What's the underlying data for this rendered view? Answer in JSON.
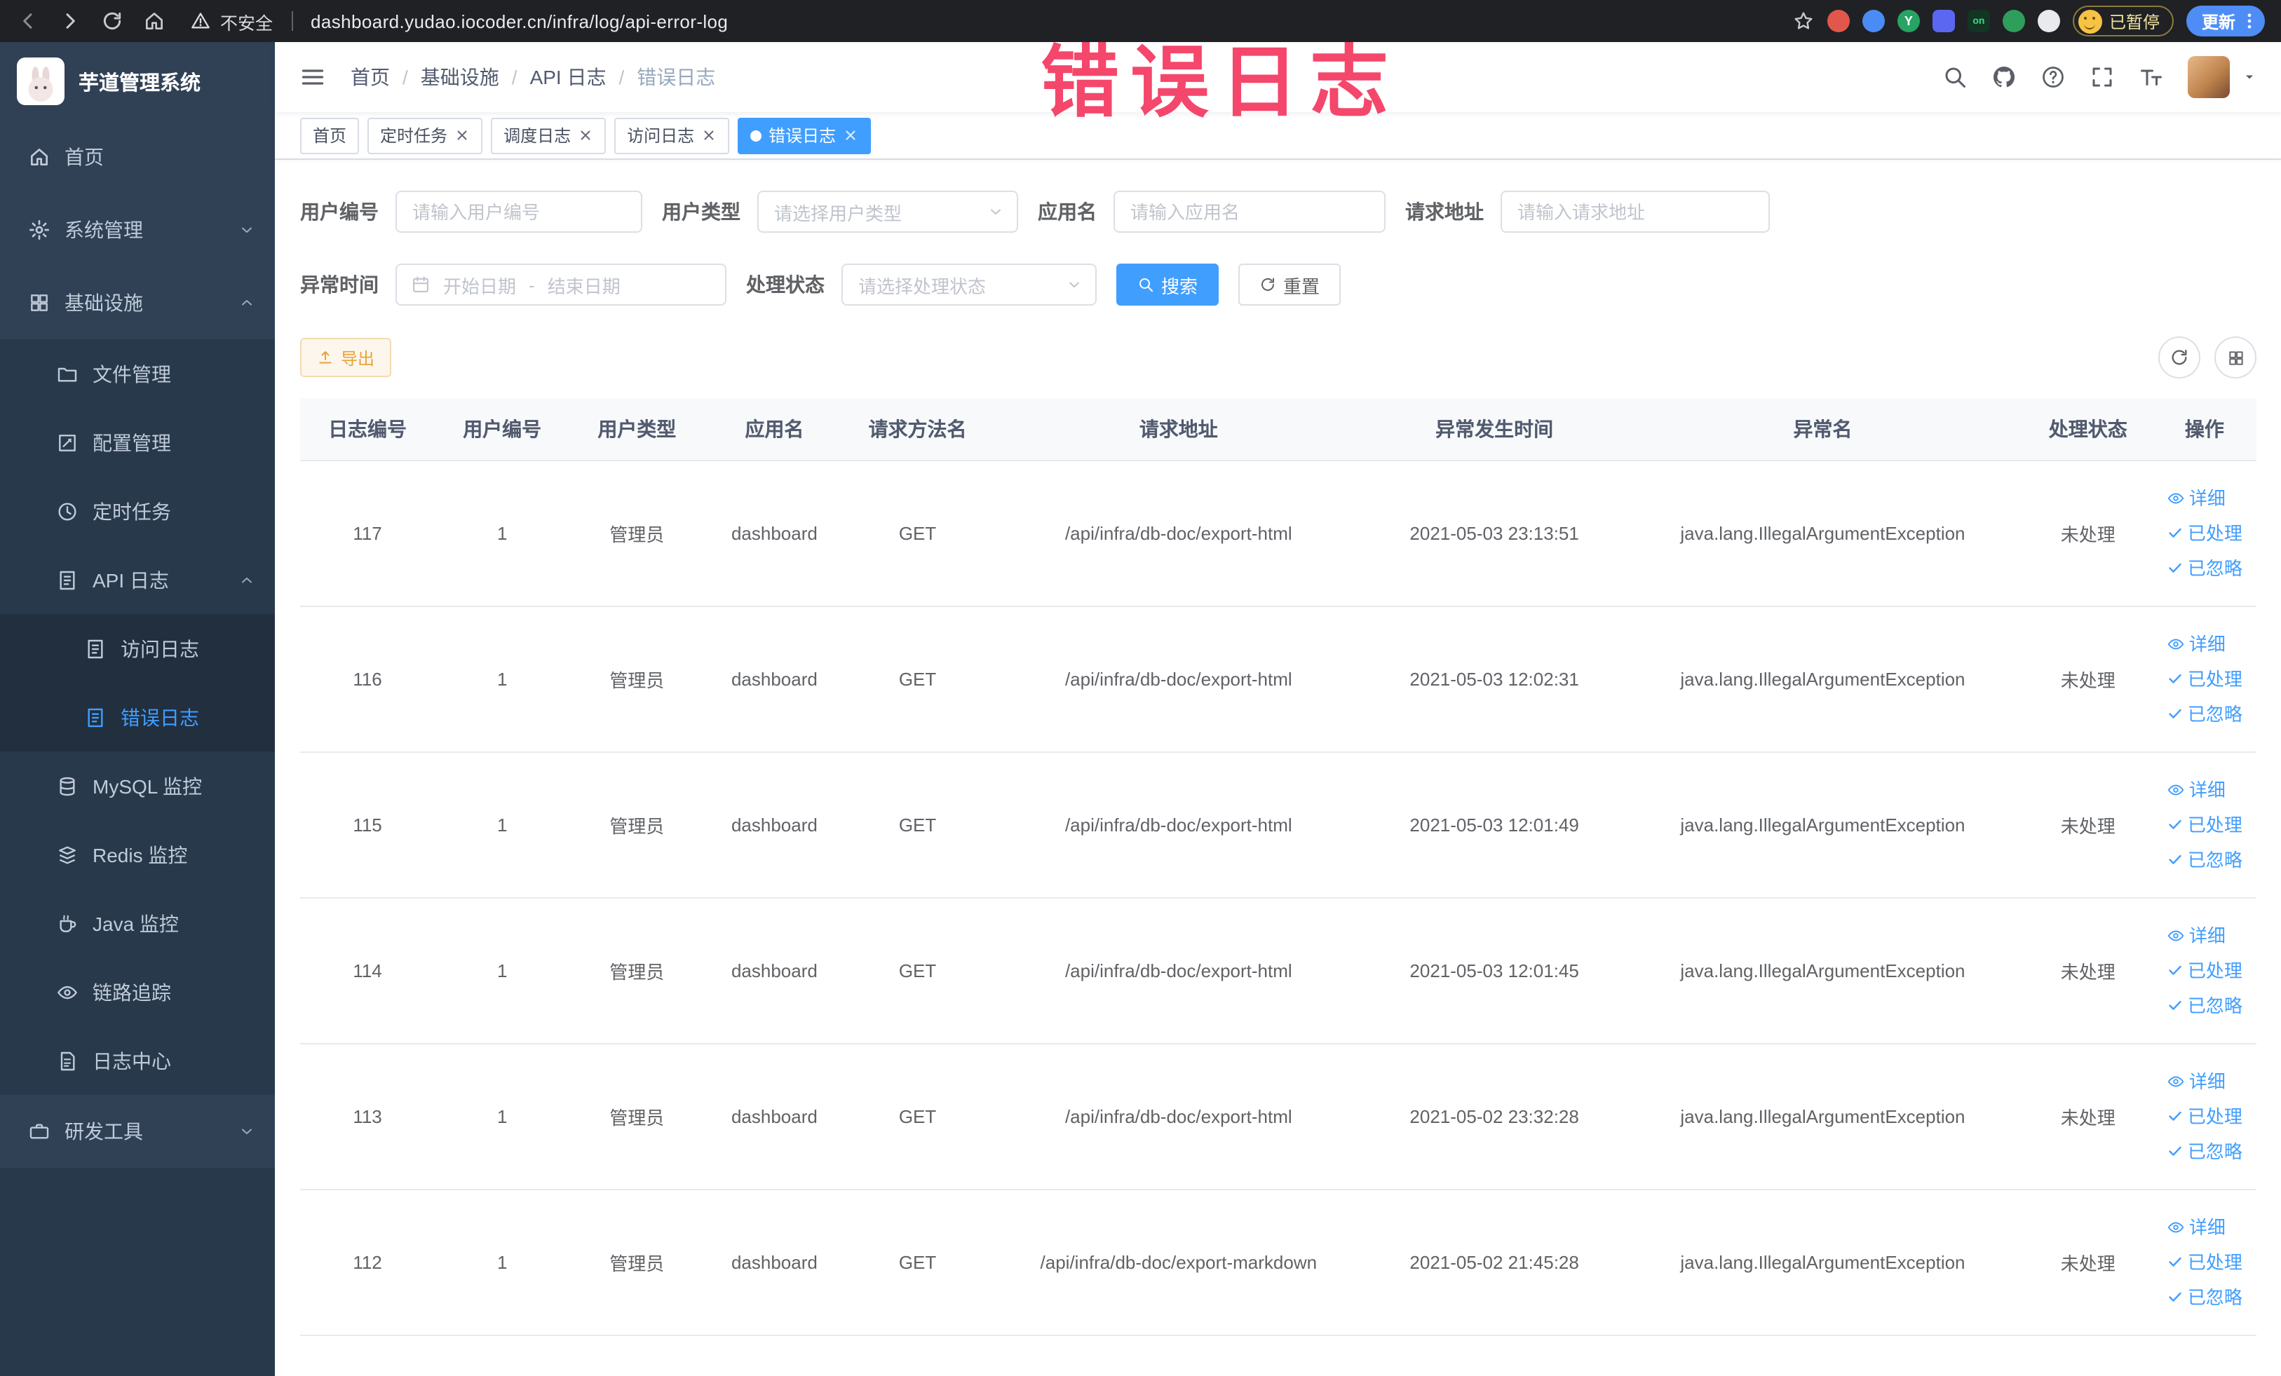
{
  "browser": {
    "security_label": "不安全",
    "url": "dashboard.yudao.iocoder.cn/infra/log/api-error-log",
    "extension_badge": "on",
    "paused_label": "已暂停",
    "update_label": "更新"
  },
  "annotation": {
    "text": "错误日志"
  },
  "sidebar": {
    "logo_title": "芋道管理系统",
    "items": [
      {
        "label": "首页"
      },
      {
        "label": "系统管理"
      },
      {
        "label": "基础设施"
      },
      {
        "label": "文件管理"
      },
      {
        "label": "配置管理"
      },
      {
        "label": "定时任务"
      },
      {
        "label": "API 日志"
      },
      {
        "label": "访问日志"
      },
      {
        "label": "错误日志"
      },
      {
        "label": "MySQL 监控"
      },
      {
        "label": "Redis 监控"
      },
      {
        "label": "Java 监控"
      },
      {
        "label": "链路追踪"
      },
      {
        "label": "日志中心"
      },
      {
        "label": "研发工具"
      }
    ]
  },
  "breadcrumb": [
    "首页",
    "基础设施",
    "API 日志",
    "错误日志"
  ],
  "breadcrumb_separator": "/",
  "tabs": [
    {
      "label": "首页"
    },
    {
      "label": "定时任务"
    },
    {
      "label": "调度日志"
    },
    {
      "label": "访问日志"
    },
    {
      "label": "错误日志"
    }
  ],
  "filters": {
    "user_id": {
      "label": "用户编号",
      "placeholder": "请输入用户编号"
    },
    "user_type": {
      "label": "用户类型",
      "placeholder": "请选择用户类型"
    },
    "app_name": {
      "label": "应用名",
      "placeholder": "请输入应用名"
    },
    "request_url": {
      "label": "请求地址",
      "placeholder": "请输入请求地址"
    },
    "exception_time": {
      "label": "异常时间",
      "start_placeholder": "开始日期",
      "separator": "-",
      "end_placeholder": "结束日期"
    },
    "status": {
      "label": "处理状态",
      "placeholder": "请选择处理状态"
    },
    "search_label": "搜索",
    "reset_label": "重置"
  },
  "toolbar": {
    "export_label": "导出"
  },
  "table": {
    "headers": [
      "日志编号",
      "用户编号",
      "用户类型",
      "应用名",
      "请求方法名",
      "请求地址",
      "异常发生时间",
      "异常名",
      "处理状态",
      "操作"
    ],
    "action_labels": {
      "detail": "详细",
      "processed": "已处理",
      "ignored": "已忽略"
    },
    "rows": [
      {
        "id": "117",
        "user_id": "1",
        "user_type": "管理员",
        "app": "dashboard",
        "method": "GET",
        "url": "/api/infra/db-doc/export-html",
        "time": "2021-05-03 23:13:51",
        "exception": "java.lang.IllegalArgumentException",
        "status": "未处理"
      },
      {
        "id": "116",
        "user_id": "1",
        "user_type": "管理员",
        "app": "dashboard",
        "method": "GET",
        "url": "/api/infra/db-doc/export-html",
        "time": "2021-05-03 12:02:31",
        "exception": "java.lang.IllegalArgumentException",
        "status": "未处理"
      },
      {
        "id": "115",
        "user_id": "1",
        "user_type": "管理员",
        "app": "dashboard",
        "method": "GET",
        "url": "/api/infra/db-doc/export-html",
        "time": "2021-05-03 12:01:49",
        "exception": "java.lang.IllegalArgumentException",
        "status": "未处理"
      },
      {
        "id": "114",
        "user_id": "1",
        "user_type": "管理员",
        "app": "dashboard",
        "method": "GET",
        "url": "/api/infra/db-doc/export-html",
        "time": "2021-05-03 12:01:45",
        "exception": "java.lang.IllegalArgumentException",
        "status": "未处理"
      },
      {
        "id": "113",
        "user_id": "1",
        "user_type": "管理员",
        "app": "dashboard",
        "method": "GET",
        "url": "/api/infra/db-doc/export-html",
        "time": "2021-05-02 23:32:28",
        "exception": "java.lang.IllegalArgumentException",
        "status": "未处理"
      },
      {
        "id": "112",
        "user_id": "1",
        "user_type": "管理员",
        "app": "dashboard",
        "method": "GET",
        "url": "/api/infra/db-doc/export-markdown",
        "time": "2021-05-02 21:45:28",
        "exception": "java.lang.IllegalArgumentException",
        "status": "未处理"
      }
    ]
  },
  "colors": {
    "primary": "#409eff",
    "warning": "#e6a23c",
    "annotation": "#f4476b",
    "sidebar_bg": "#304156",
    "chrome_bg": "#202124"
  }
}
